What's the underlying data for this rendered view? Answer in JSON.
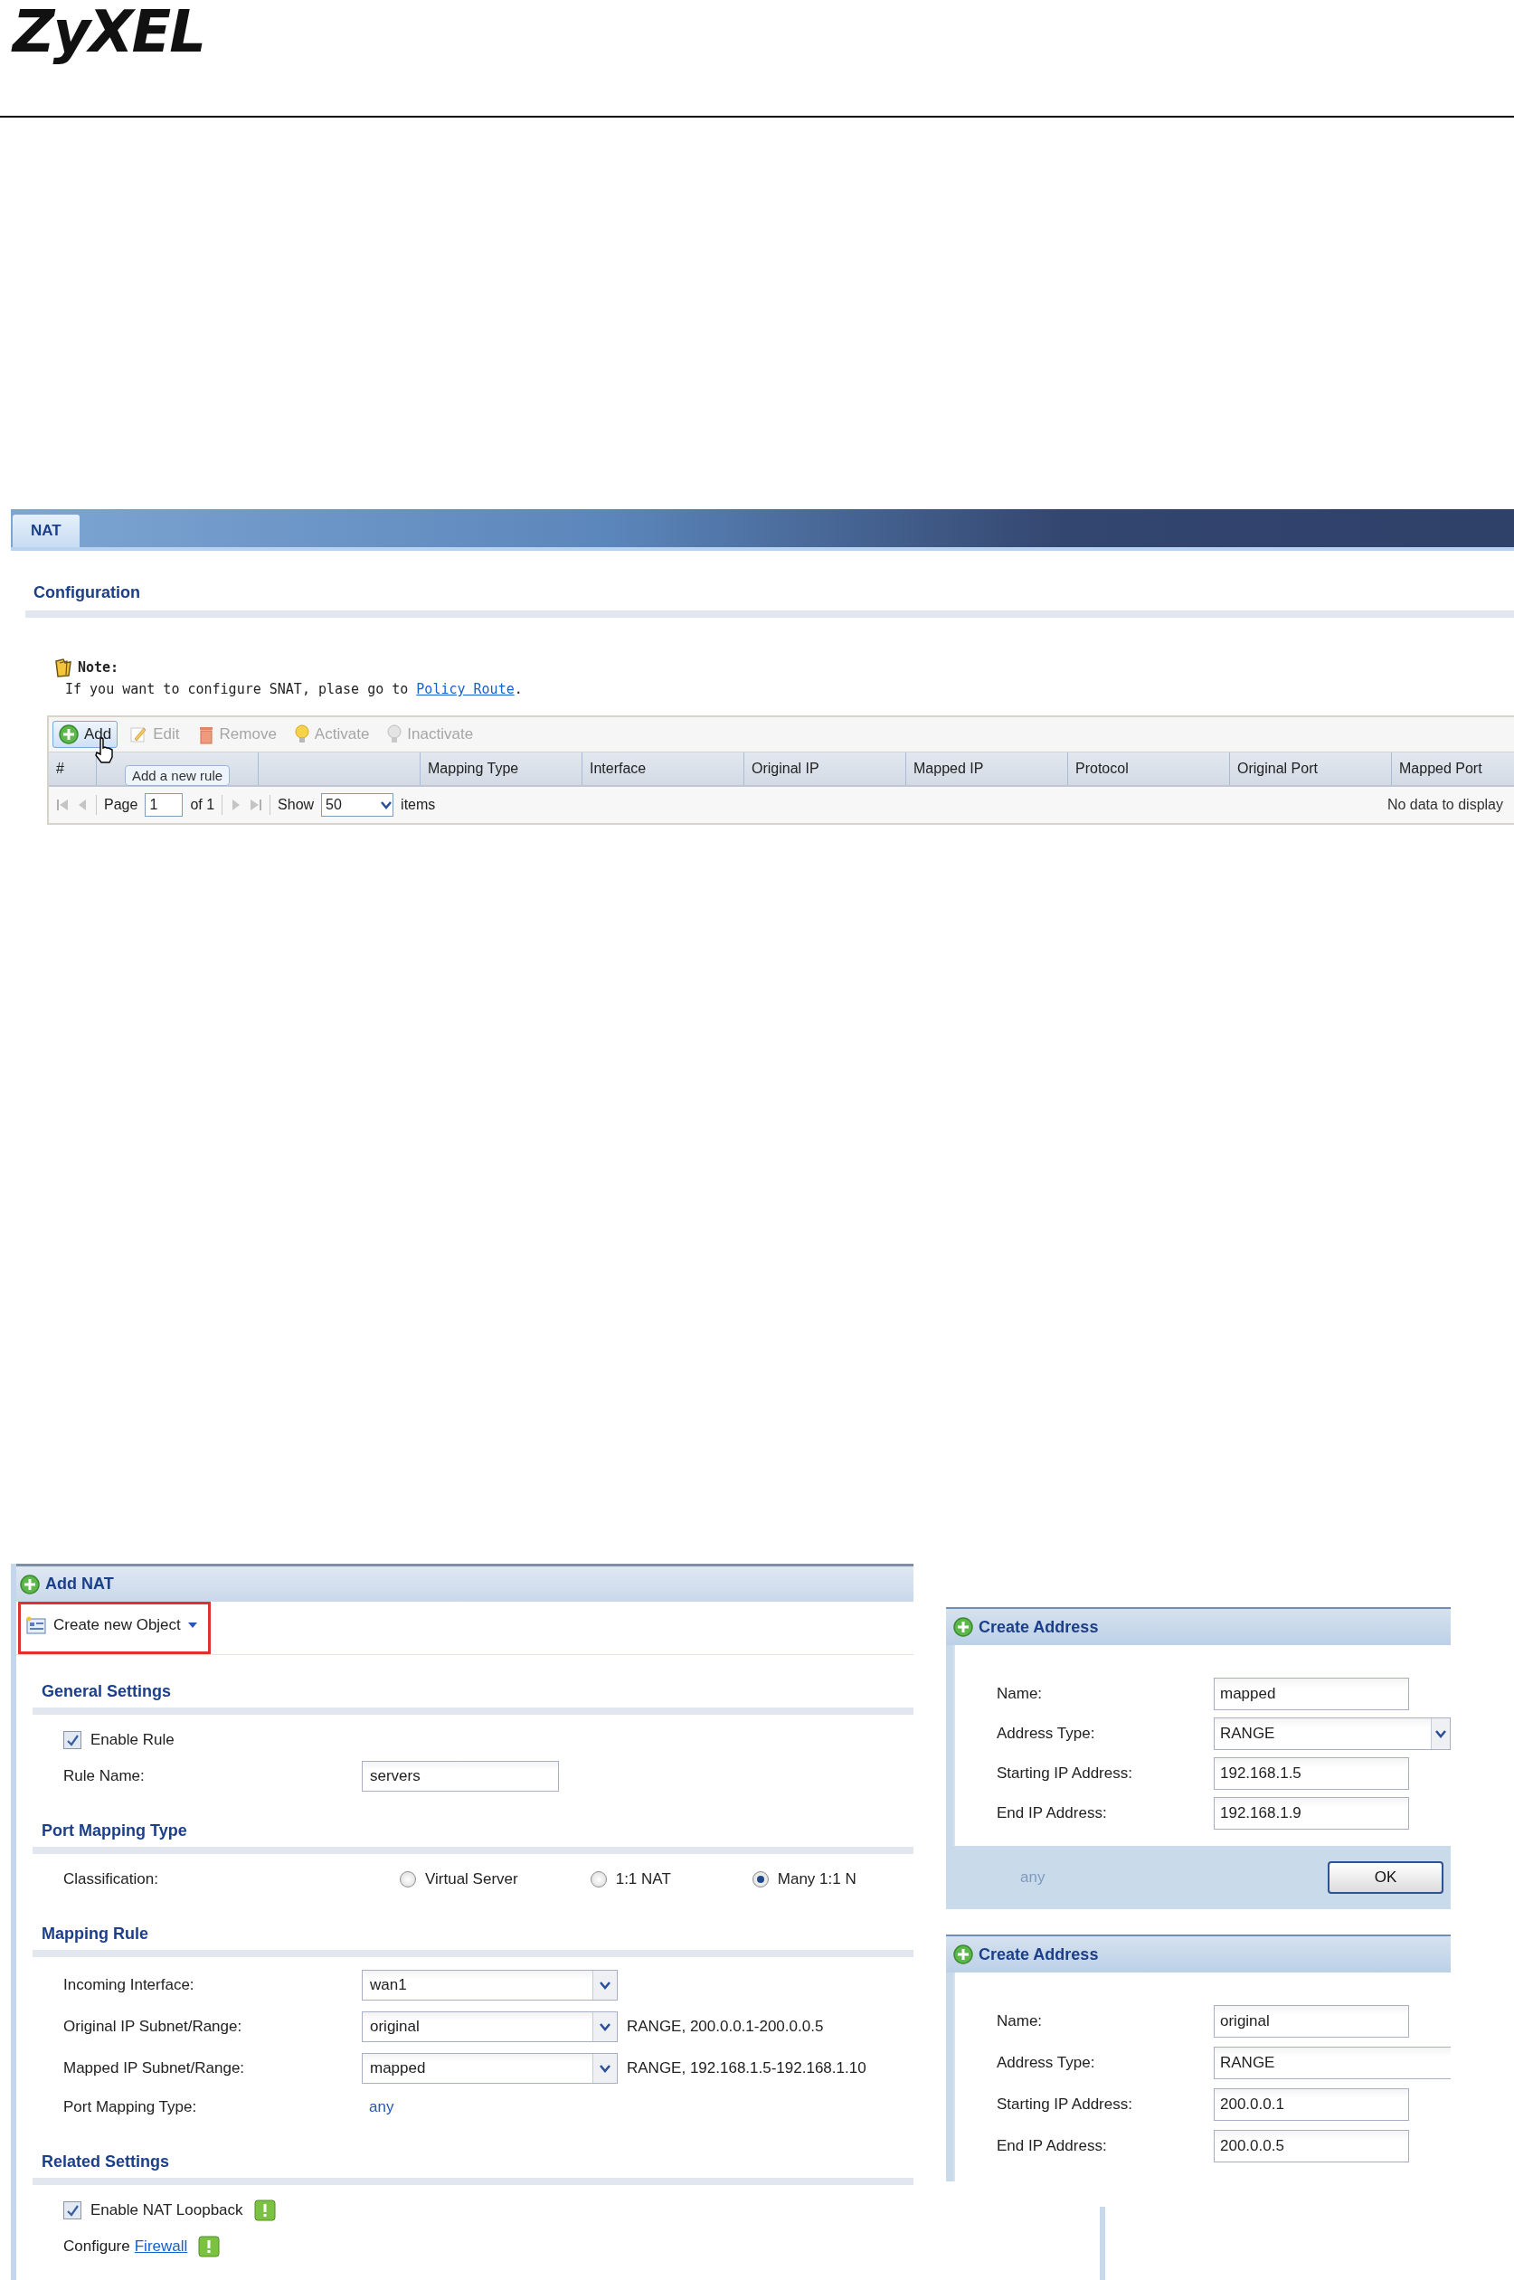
{
  "logo": "ZyXEL",
  "nat": {
    "tabs": [
      {
        "label": "NAT",
        "selected": true
      }
    ],
    "heading": "Configuration",
    "note": {
      "title": "Note:",
      "text": "If you want to configure SNAT, plase go to ",
      "link": "Policy Route",
      "end": "."
    },
    "toolbar": [
      {
        "kind": "add",
        "label": "Add",
        "disabled": false,
        "hovered": true
      },
      {
        "kind": "edit",
        "label": "Edit",
        "disabled": true,
        "hovered": false
      },
      {
        "kind": "remove",
        "label": "Remove",
        "disabled": true,
        "hovered": false
      },
      {
        "kind": "activate",
        "label": "Activate",
        "disabled": true,
        "hovered": false
      },
      {
        "kind": "inactivate",
        "label": "Inactivate",
        "disabled": true,
        "hovered": false
      }
    ],
    "tooltip": "Add a new rule",
    "columns": [
      {
        "label": "#",
        "covered": false
      },
      {
        "covered": true
      },
      {
        "covered": true
      },
      {
        "label": "Mapping Type",
        "covered": false
      },
      {
        "label": "Interface",
        "covered": false
      },
      {
        "label": "Original IP",
        "covered": false
      },
      {
        "label": "Mapped IP",
        "covered": false
      },
      {
        "label": "Protocol",
        "covered": false
      },
      {
        "label": "Original Port",
        "covered": false
      },
      {
        "label": "Mapped Port",
        "covered": false
      }
    ],
    "pager": {
      "page_label": "Page",
      "page": "1",
      "of": "of 1",
      "show_label": "Show",
      "show": "50",
      "items": "items",
      "message": "No data to display"
    }
  },
  "add_nat": {
    "title": "Add NAT",
    "create_object": "Create new Object",
    "sections": [
      {
        "title": "General Settings",
        "rows": [
          {
            "kind": "checkbox",
            "label": "Enable Rule",
            "checked": true,
            "warning": false
          },
          {
            "kind": "text",
            "label": "Rule Name:",
            "value": "servers"
          }
        ]
      },
      {
        "title": "Port Mapping Type",
        "rows": [
          {
            "kind": "radio",
            "label": "Classification:",
            "options": [
              {
                "label": "Virtual Server",
                "selected": false
              },
              {
                "label": "1:1 NAT",
                "selected": false
              },
              {
                "label": "Many 1:1 N",
                "selected": true
              }
            ]
          }
        ]
      },
      {
        "title": "Mapping Rule",
        "rows": [
          {
            "kind": "select",
            "label": "Incoming Interface:",
            "value": "wan1"
          },
          {
            "kind": "select",
            "label": "Original IP Subnet/Range:",
            "value": "original",
            "info": "RANGE, 200.0.0.1-200.0.0.5"
          },
          {
            "kind": "select",
            "label": "Mapped IP Subnet/Range:",
            "value": "mapped",
            "info": "RANGE, 192.168.1.5-192.168.1.10"
          },
          {
            "kind": "static",
            "label": "Port Mapping Type:",
            "value": "any"
          }
        ]
      },
      {
        "title": "Related Settings",
        "rows": [
          {
            "kind": "checkbox",
            "label": "Enable NAT Loopback",
            "checked": true,
            "warning": true
          },
          {
            "kind": "link",
            "label": "Configure",
            "link": "Firewall",
            "warning": true
          }
        ]
      }
    ]
  },
  "dialogs": [
    {
      "title": "Create Address",
      "fields": [
        {
          "kind": "text",
          "label": "Name:",
          "value": "mapped"
        },
        {
          "kind": "select",
          "label": "Address Type:",
          "value": "RANGE"
        },
        {
          "kind": "text",
          "label": "Starting IP Address:",
          "value": "192.168.1.5"
        },
        {
          "kind": "text",
          "label": "End IP Address:",
          "value": "192.168.1.9"
        }
      ],
      "ghost_text": "any",
      "button": "OK"
    },
    {
      "title": "Create Address",
      "fields": [
        {
          "kind": "text",
          "label": "Name:",
          "value": "original"
        },
        {
          "kind": "wide",
          "label": "Address Type:",
          "value": "RANGE"
        },
        {
          "kind": "text",
          "label": "Starting IP Address:",
          "value": "200.0.0.1"
        },
        {
          "kind": "text",
          "label": "End IP Address:",
          "value": "200.0.0.5"
        }
      ]
    }
  ]
}
